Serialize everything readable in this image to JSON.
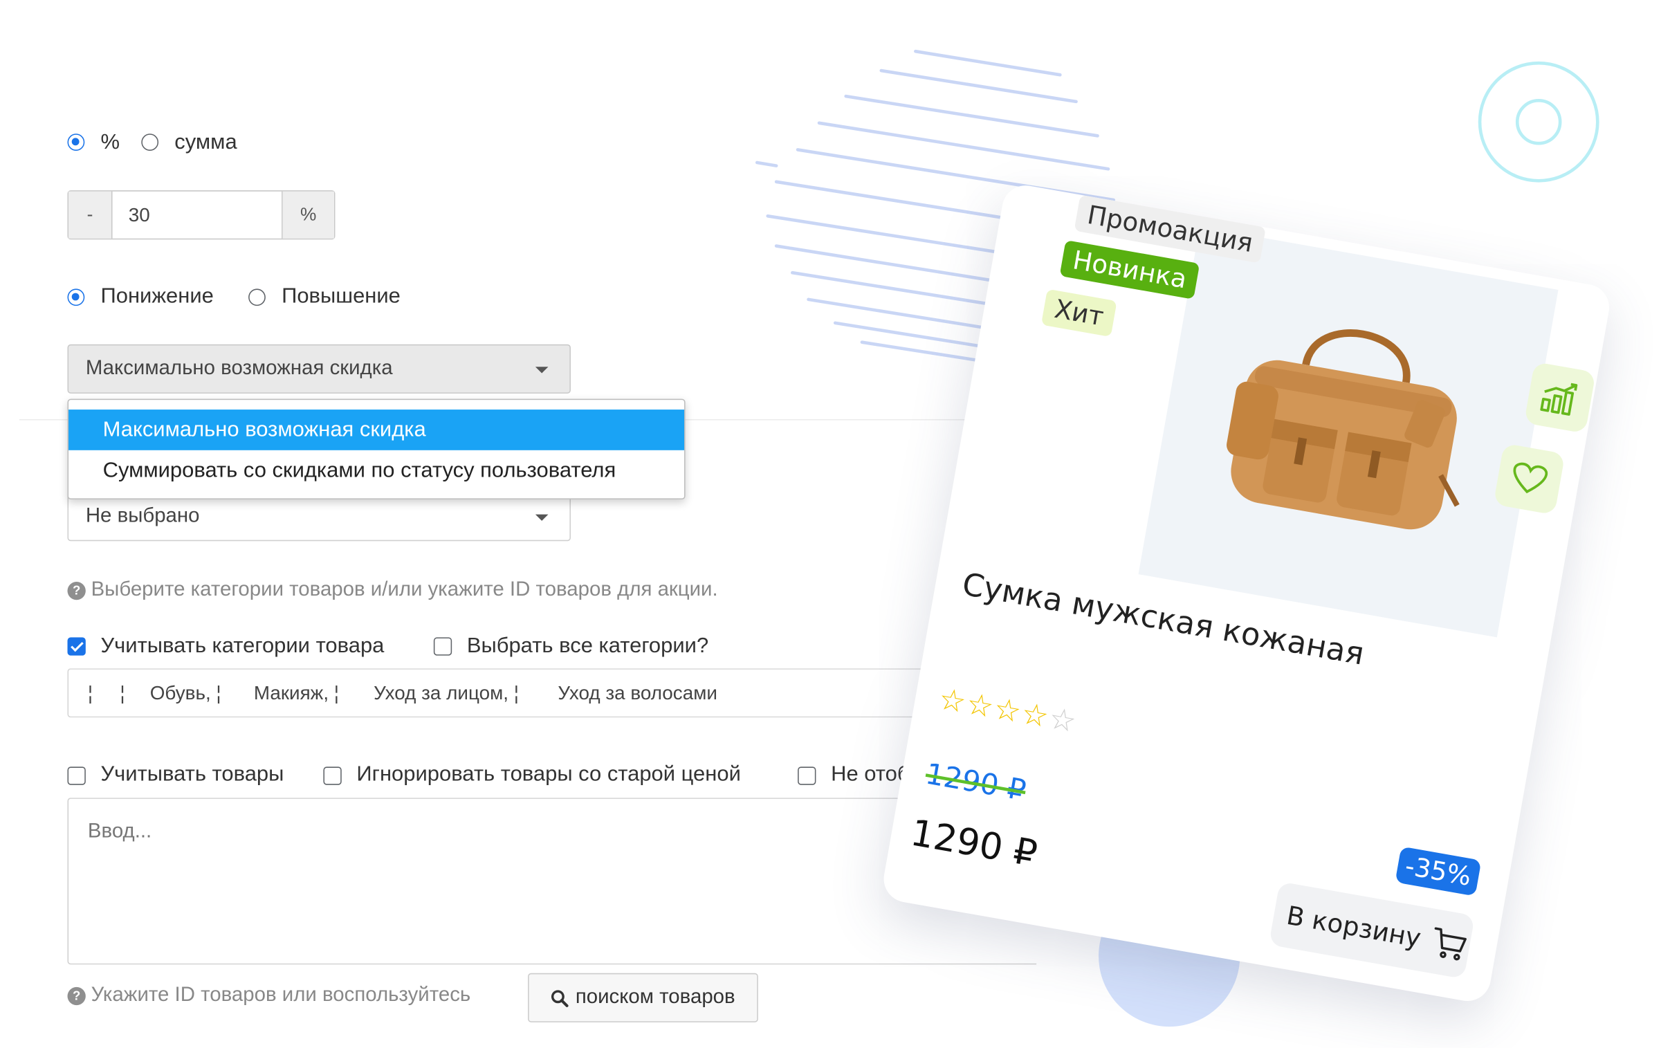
{
  "discount_type": {
    "options": [
      "%",
      "сумма"
    ],
    "selected": "%"
  },
  "amount": {
    "minus": "-",
    "value": "30",
    "unit": "%"
  },
  "direction": {
    "options": [
      "Понижение",
      "Повышение"
    ],
    "selected": "Понижение"
  },
  "mode_select": {
    "value": "Максимально возможная скидка",
    "options": [
      "Максимально возможная скидка",
      "Суммировать со скидками по статусу пользователя"
    ],
    "highlighted": "Максимально возможная скидка"
  },
  "second_select": {
    "value": "Не выбрано"
  },
  "hint_categories": "Выберите категории товаров и/или укажите ID товаров для акции.",
  "category_checks": {
    "consider_categories": "Учитывать категории товара",
    "select_all": "Выбрать все категории?"
  },
  "categories_field": {
    "items": [
      "¦",
      "¦",
      "Обувь, ¦",
      "Макияж, ¦",
      "Уход за лицом, ¦",
      "Уход за волосами"
    ]
  },
  "product_checks": {
    "consider_products": "Учитывать товары",
    "ignore_old_price": "Игнорировать товары со старой ценой",
    "do_not_show": "Не отображ"
  },
  "products_textarea": {
    "placeholder": "Ввод..."
  },
  "hint_products": "Укажите ID товаров или воспользуйтесь",
  "search_button": "поиском товаров",
  "card": {
    "tags": [
      "Промоакция",
      "Новинка",
      "Хит"
    ],
    "name": "Сумка мужская кожаная",
    "rating": 4,
    "rating_max": 5,
    "old_price": "1290 ₽",
    "price": "1290 ₽",
    "discount_badge": "-35%",
    "cart_button": "В корзину",
    "colors": {
      "accent_green": "#58b010",
      "accent_blue": "#1a73e8"
    }
  },
  "colors": {
    "primary": "#1a73e8",
    "dropdown_highlight": "#1aa3f5",
    "decor_lines": "#c9d6f5",
    "decor_ring": "#b8eef5"
  }
}
